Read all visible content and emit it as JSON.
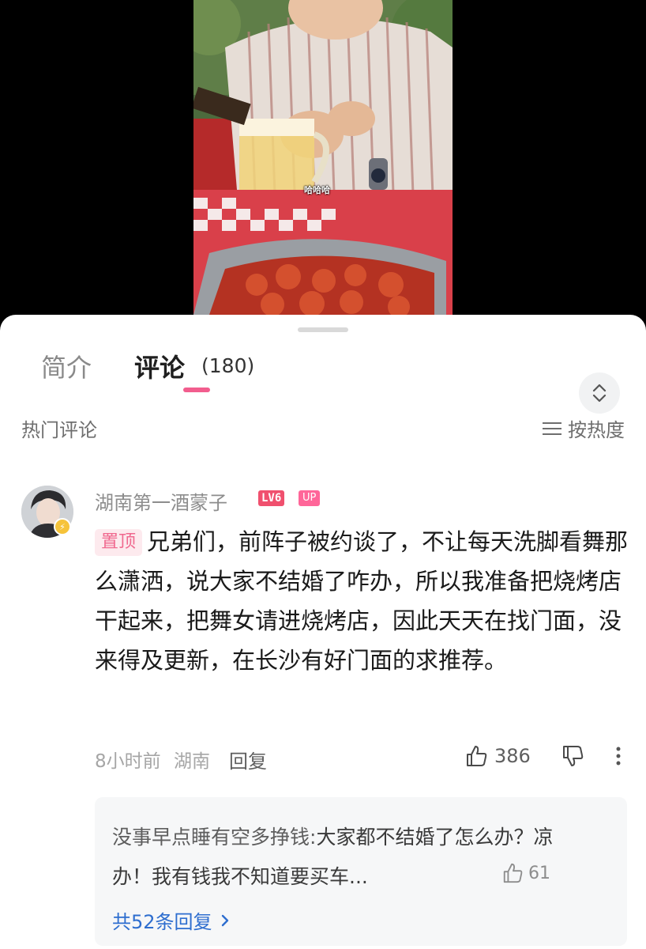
{
  "video": {
    "subtitle": "哈哈哈"
  },
  "tabs": [
    {
      "label": "简介"
    },
    {
      "label": "评论",
      "count": "(180)"
    }
  ],
  "section": {
    "title": "热门评论",
    "sort_label": "按热度"
  },
  "comment": {
    "username": "湖南第一酒蒙子",
    "level": "LV6",
    "up_badge": "UP",
    "pin_tag": "置顶",
    "text": "兄弟们，前阵子被约谈了，不让每天洗脚看舞那么潇洒，说大家不结婚了咋办，所以我准备把烧烤店干起来，把舞女请进烧烤店，因此天天在找门面，没来得及更新，在长沙有好门面的求推荐。",
    "time": "8小时前",
    "location": "湖南",
    "reply_label": "回复",
    "likes": "386"
  },
  "sub_replies": {
    "author": "没事早点睡有空多挣钱:",
    "text": "大家都不结婚了怎么办？凉办！我有钱我不知道要买车...",
    "likes": "61",
    "total_label": "共52条回复"
  },
  "icons": {
    "expand": "chevron-up-down-icon",
    "sort": "menu-lines-icon",
    "like": "thumbs-up-icon",
    "dislike": "thumbs-down-icon",
    "more": "more-vertical-icon",
    "arrow": "chevron-right-icon"
  },
  "colors": {
    "accent": "#f25d8e",
    "link": "#2e6ecf",
    "level_badge": "#f0506e"
  }
}
